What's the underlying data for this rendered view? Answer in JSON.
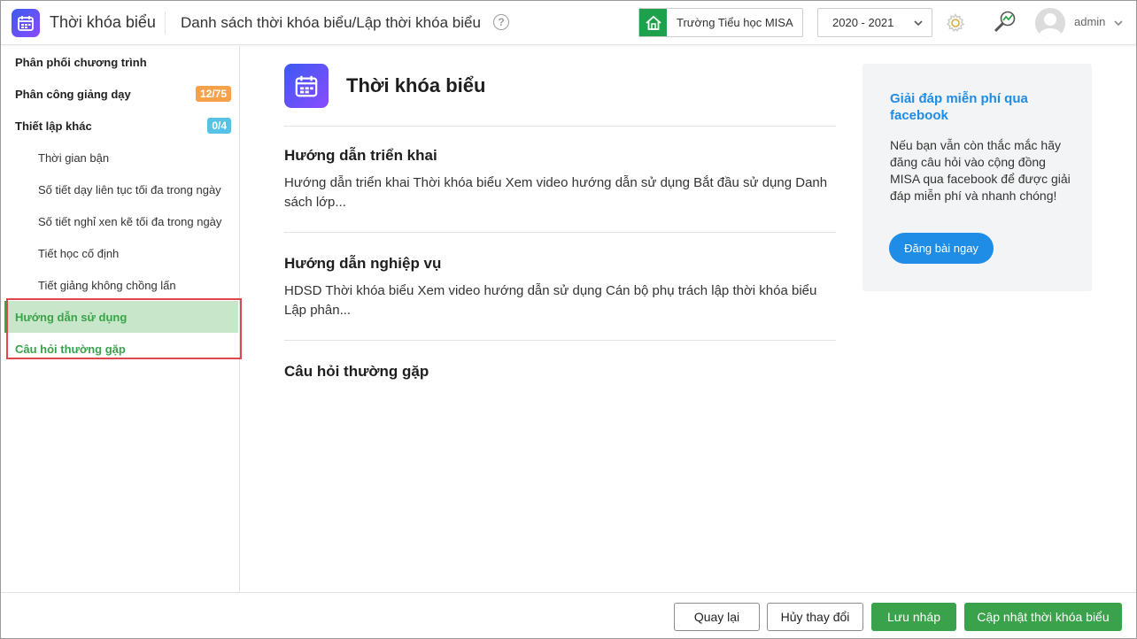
{
  "app": {
    "title": "Thời khóa biểu"
  },
  "header": {
    "breadcrumb": "Danh sách thời khóa biểu/Lập thời khóa biểu",
    "help_icon": "?",
    "school": "Trường Tiểu học MISA",
    "year": "2020 - 2021",
    "user": "admin"
  },
  "sidebar": {
    "items": [
      {
        "label": "Phân phối chương trình"
      },
      {
        "label": "Phân công giảng dạy",
        "badge": "12/75"
      },
      {
        "label": "Thiết lập khác",
        "badge": "0/4"
      },
      {
        "label": "Thời gian bận"
      },
      {
        "label": "Số tiết dạy liên tục tối đa trong ngày"
      },
      {
        "label": "Số tiết nghỉ xen kẽ tối đa trong ngày"
      },
      {
        "label": "Tiết học cố định"
      },
      {
        "label": "Tiết giảng không chồng lấn"
      },
      {
        "label": "Hướng dẫn sử dụng"
      },
      {
        "label": "Câu hỏi thường gặp"
      }
    ]
  },
  "main": {
    "title": "Thời khóa biểu",
    "sections": [
      {
        "title": "Hướng dẫn triển khai",
        "text": "Hướng dẫn triển khai Thời khóa biểu Xem video hướng dẫn sử dụng Bắt đầu sử dụng Danh sách lớp..."
      },
      {
        "title": "Hướng dẫn nghiệp vụ",
        "text": "HDSD Thời khóa biểu Xem video hướng dẫn sử dụng Cán bộ phụ trách lập thời khóa biểu Lập phân..."
      },
      {
        "title": "Câu hỏi thường gặp"
      }
    ]
  },
  "facebook_card": {
    "title": "Giải đáp miễn phí qua facebook",
    "text": "Nếu bạn vẫn còn thắc mắc hãy đăng câu hỏi vào cộng đồng MISA qua facebook để được giải đáp miễn phí và nhanh chóng!",
    "button": "Đăng bài ngay"
  },
  "footer": {
    "back": "Quay lại",
    "cancel": "Hủy thay đổi",
    "save_draft": "Lưu nháp",
    "update": "Cập nhật thời khóa biểu"
  },
  "colors": {
    "accent_green": "#3aa24a",
    "active_bg": "#c8e6c9",
    "facebook_blue": "#1f8ce6",
    "badge_orange": "#f7a24b",
    "badge_cyan": "#56c2e6",
    "highlight_red": "#e0474c"
  },
  "icons": {
    "app": "calendar-icon",
    "school": "home-icon",
    "settings": "gear-icon",
    "tools": "chart-search-icon",
    "avatar": "user-avatar"
  }
}
